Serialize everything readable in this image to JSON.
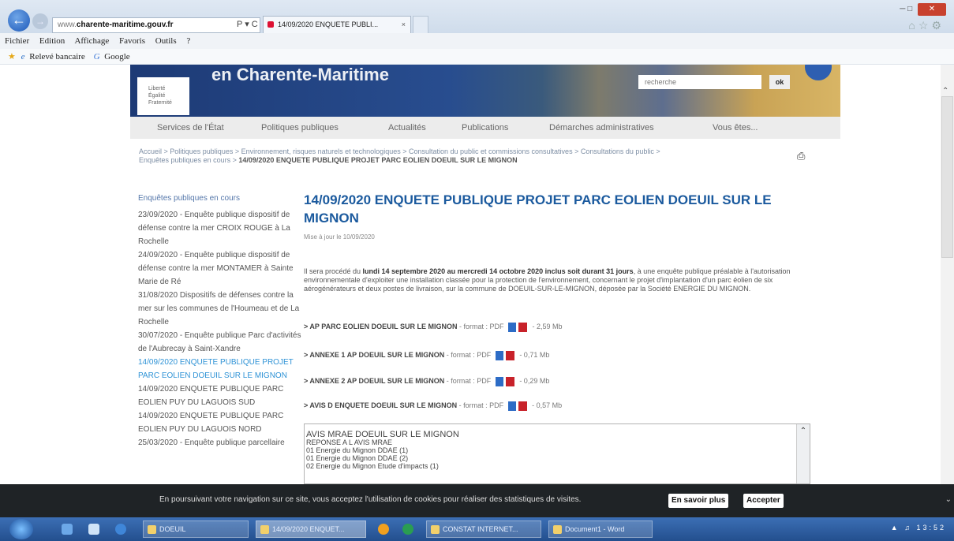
{
  "browser": {
    "url_domain": "charente-maritime.gouv.fr",
    "url_rest": "www.",
    "address_icons": "P ▾ C",
    "tab_title": "14/09/2020 ENQUETE PUBLI...",
    "tab_close": "×",
    "menu": [
      "Fichier",
      "Edition",
      "Affichage",
      "Favoris",
      "Outils",
      "?"
    ],
    "favorites": [
      "Relevé bancaire",
      "Google"
    ]
  },
  "site": {
    "banner_title": "en Charente-Maritime",
    "search_placeholder": "recherche",
    "search_ok": "ok",
    "nav": [
      "Services de l'État",
      "Politiques publiques",
      "Actualités",
      "Publications",
      "Démarches administratives",
      "Vous êtes..."
    ],
    "breadcrumb": "Accueil > Politiques publiques > Environnement, risques naturels et technologiques > Consultation du public et commissions consultatives > Consultations du public > Enquêtes publiques en cours >",
    "breadcrumb_current": "14/09/2020 ENQUETE PUBLIQUE PROJET PARC EOLIEN DOEUIL SUR LE MIGNON"
  },
  "sidebar": {
    "title": "Enquêtes publiques en cours",
    "items": [
      {
        "text": "23/09/2020 - Enquête publique dispositif de défense contre la mer CROIX ROUGE à La Rochelle",
        "active": false
      },
      {
        "text": "24/09/2020 - Enquête publique dispositif de défense contre la mer MONTAMER à Sainte Marie de Ré",
        "active": false
      },
      {
        "text": "31/08/2020 Dispositifs de défenses contre la mer sur les communes de l'Houmeau et de La Rochelle",
        "active": false
      },
      {
        "text": "30/07/2020 - Enquête publique Parc d'activités de l'Aubrecay à Saint-Xandre",
        "active": false
      },
      {
        "text": "14/09/2020 ENQUETE PUBLIQUE PROJET PARC EOLIEN DOEUIL SUR LE MIGNON",
        "active": true
      },
      {
        "text": "14/09/2020 ENQUETE PUBLIQUE PARC EOLIEN PUY DU LAGUOIS SUD",
        "active": false
      },
      {
        "text": "14/09/2020 ENQUETE PUBLIQUE PARC EOLIEN PUY DU LAGUOIS NORD",
        "active": false
      },
      {
        "text": "25/03/2020 - Enquête publique parcellaire",
        "active": false
      }
    ]
  },
  "article": {
    "title": "14/09/2020 ENQUETE PUBLIQUE PROJET PARC EOLIEN DOEUIL SUR LE MIGNON",
    "updated": "Mise à jour le 10/09/2020",
    "intro_pre": "Il sera procédé du ",
    "intro_bold": "lundi 14 septembre 2020 au mercredi 14 octobre 2020 inclus soit durant 31 jours",
    "intro_post": ", à une enquête publique préalable à l'autorisation environnementale d'exploiter une installation classée pour la protection de l'environnement, concernant le projet d'implantation d'un parc éolien de six aérogénérateurs et deux postes de livraison, sur la commune de DOEUIL-SUR-LE-MIGNON, déposée par la Société ENERGIE DU MIGNON.",
    "downloads": [
      {
        "name": "> AP PARC EOLIEN DOEUIL SUR LE MIGNON",
        "meta": " - format : PDF",
        "size": "- 2,59 Mb"
      },
      {
        "name": "> ANNEXE 1 AP DOEUIL SUR LE MIGNON",
        "meta": " - format : PDF",
        "size": "- 0,71 Mb"
      },
      {
        "name": "> ANNEXE 2 AP DOEUIL SUR LE MIGNON",
        "meta": " - format : PDF",
        "size": "- 0,29 Mb"
      },
      {
        "name": "> AVIS D ENQUETE DOEUIL SUR LE MIGNON",
        "meta": " - format : PDF",
        "size": "- 0,57 Mb"
      }
    ],
    "listbox": [
      "AVIS MRAE DOEUIL SUR LE MIGNON",
      "REPONSE A L AVIS MRAE",
      "01 Energie du Mignon DDAE (1)",
      "01 Energie du Mignon DDAE (2)",
      "02 Energie du Mignon Etude d'impacts (1)"
    ]
  },
  "cookie": {
    "text": "En poursuivant votre navigation sur ce site, vous acceptez l'utilisation de cookies pour réaliser des statistiques de visites.",
    "more": "En savoir plus",
    "accept": "Accepter"
  },
  "taskbar": {
    "buttons": [
      "DOEUIL",
      "14/09/2020 ENQUET...",
      "CONSTAT INTERNET...",
      "Document1 - Word"
    ],
    "clock": "13:52"
  }
}
